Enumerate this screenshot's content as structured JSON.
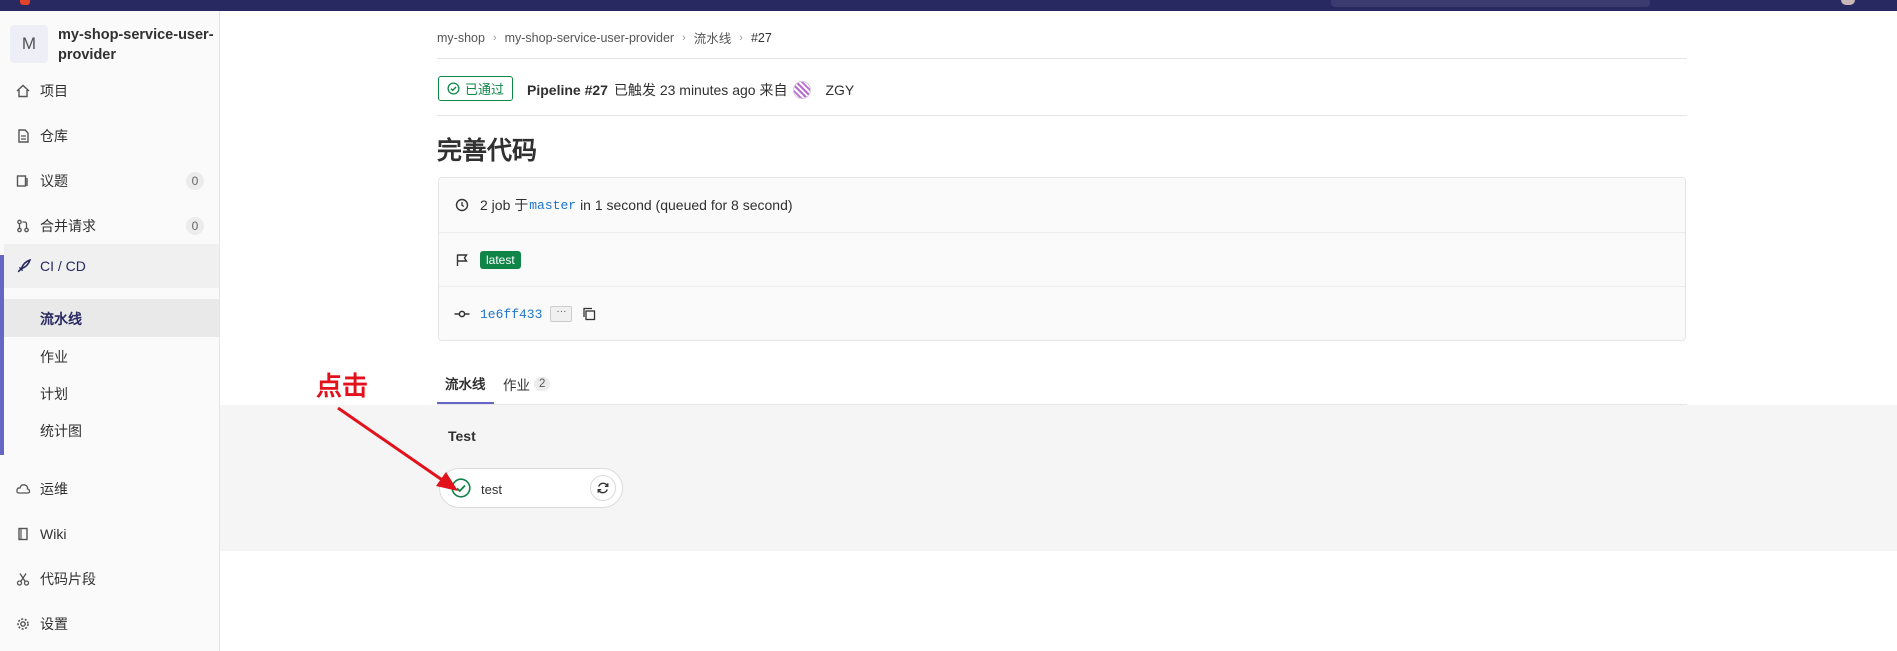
{
  "project": {
    "avatar_letter": "M",
    "name": "my-shop-service-user-provider"
  },
  "sidebar": {
    "items": [
      {
        "label": "项目",
        "icon": "home-icon"
      },
      {
        "label": "仓库",
        "icon": "repository-icon"
      },
      {
        "label": "议题",
        "icon": "issues-icon",
        "count": "0"
      },
      {
        "label": "合并请求",
        "icon": "merge-request-icon",
        "count": "0"
      },
      {
        "label": "CI / CD",
        "icon": "rocket-icon"
      },
      {
        "label": "运维",
        "icon": "cloud-icon"
      },
      {
        "label": "Wiki",
        "icon": "book-icon"
      },
      {
        "label": "代码片段",
        "icon": "snippet-icon"
      },
      {
        "label": "设置",
        "icon": "settings-icon"
      }
    ],
    "cicd_sub": [
      "流水线",
      "作业",
      "计划",
      "统计图"
    ]
  },
  "breadcrumb": [
    "my-shop",
    "my-shop-service-user-provider",
    "流水线",
    "#27"
  ],
  "pipeline": {
    "status": "已通过",
    "id_label": "Pipeline #27",
    "triggered": "已触发 23 minutes ago 来自",
    "user": "ZGY",
    "title": "完善代码",
    "jobs_prefix": "2 job 于",
    "branch": "master",
    "duration": "in 1 second (queued for 8 second)",
    "tag": "latest",
    "commit": "1e6ff433",
    "more": "···"
  },
  "tabs": [
    {
      "label": "流水线"
    },
    {
      "label": "作业",
      "count": "2"
    }
  ],
  "graph": {
    "stage": "Test",
    "job": "test"
  },
  "annotation": "点击",
  "colors": {
    "success": "#108548",
    "accent": "#6666c4",
    "topbar": "#292961",
    "annotation": "#e2111b"
  }
}
